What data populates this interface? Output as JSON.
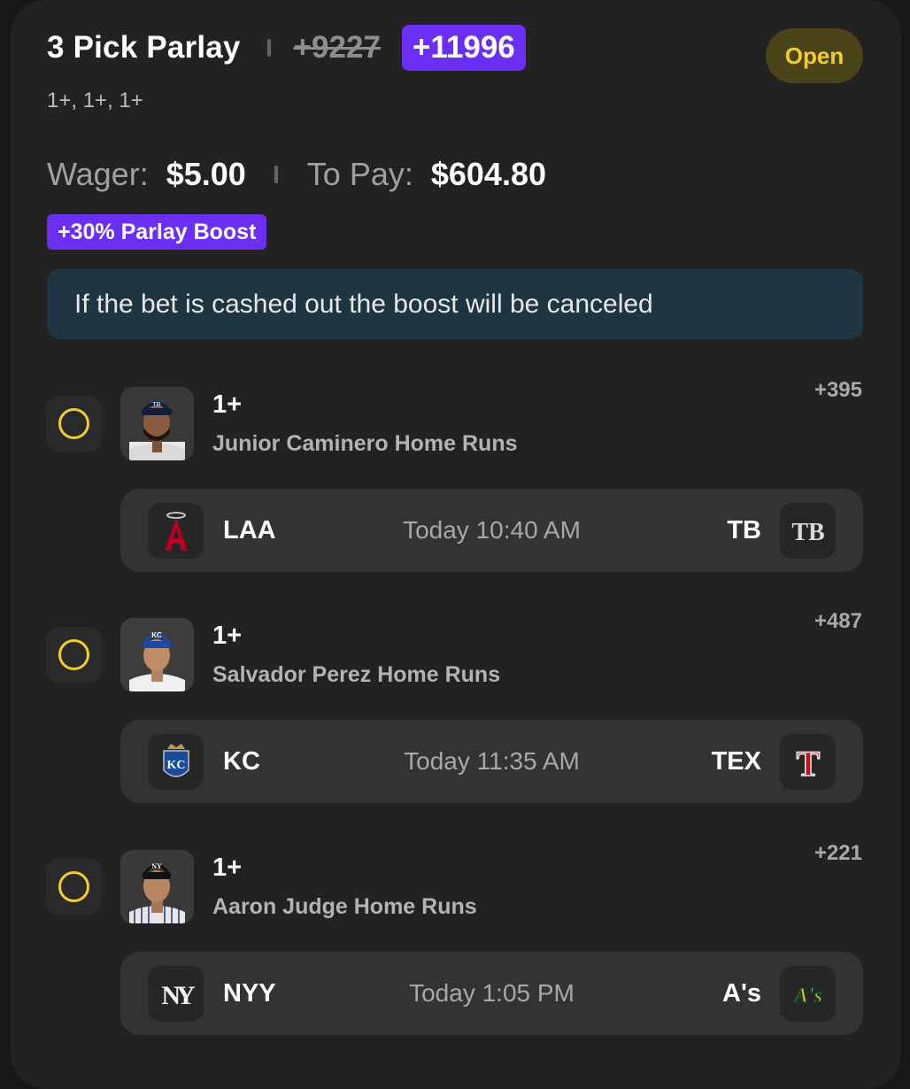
{
  "header": {
    "title": "3 Pick Parlay",
    "original_odds": "+9227",
    "boosted_odds": "+11996",
    "status": "Open",
    "legs_summary": "1+, 1+, 1+"
  },
  "wager": {
    "wager_label": "Wager:",
    "wager_value": "$5.00",
    "to_pay_label": "To Pay:",
    "to_pay_value": "$604.80"
  },
  "boost_badge": "+30% Parlay Boost",
  "notice": "If the bet is cashed out the boost will be canceled",
  "legs": [
    {
      "line": "1+",
      "market": "Junior Caminero Home Runs",
      "odds": "+395",
      "game": {
        "away": "LAA",
        "time": "Today 10:40 AM",
        "home": "TB",
        "away_logo_text": "A",
        "home_logo_text": "TB"
      }
    },
    {
      "line": "1+",
      "market": "Salvador Perez Home Runs",
      "odds": "+487",
      "game": {
        "away": "KC",
        "time": "Today 11:35 AM",
        "home": "TEX",
        "away_logo_text": "KC",
        "home_logo_text": "T"
      }
    },
    {
      "line": "1+",
      "market": "Aaron Judge Home Runs",
      "odds": "+221",
      "game": {
        "away": "NYY",
        "time": "Today 1:05 PM",
        "home": "A's",
        "away_logo_text": "NY",
        "home_logo_text": "A's"
      }
    }
  ],
  "colors": {
    "accent_purple": "#6b2ef5",
    "status_yellow": "#f1ce2e",
    "notice_bg": "#1e3542",
    "card_bg": "#222222"
  },
  "icons": {
    "radio": "radio-unselected-icon",
    "avatar": "player-headshot",
    "team_logo": "team-logo-icon"
  }
}
